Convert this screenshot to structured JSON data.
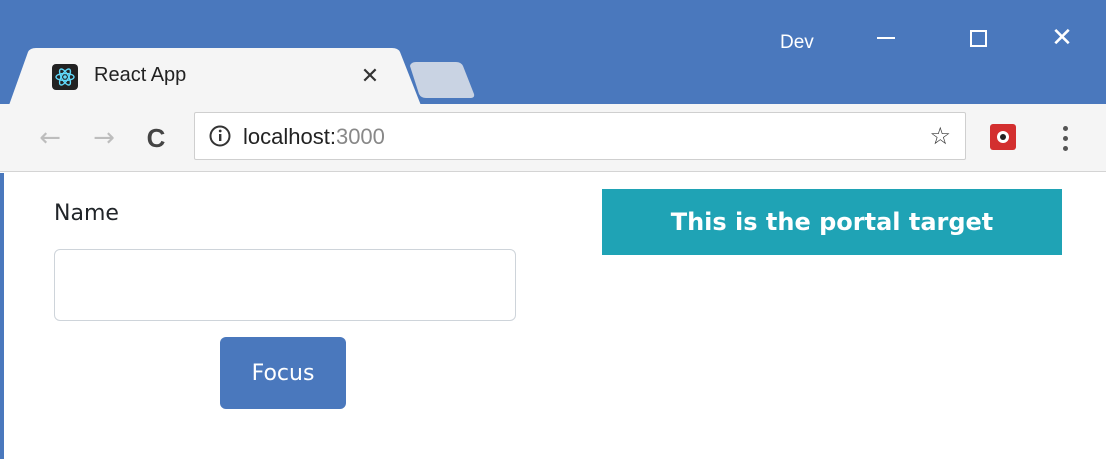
{
  "window": {
    "profile_name": "Dev",
    "titlebar_color": "#4a78bd"
  },
  "tabs": [
    {
      "title": "React App",
      "active": true,
      "favicon": "react-logo-icon"
    }
  ],
  "toolbar": {
    "back_icon": "←",
    "forward_icon": "→",
    "reload_icon": "C",
    "url_host": "localhost:",
    "url_port": "3000",
    "bookmark_icon": "☆",
    "extension": "red-extension-icon"
  },
  "page": {
    "name_label": "Name",
    "name_value": "",
    "focus_button_label": "Focus",
    "portal_text": "This is the portal target",
    "portal_color": "#1fa3b5",
    "button_color": "#4a78bd"
  }
}
